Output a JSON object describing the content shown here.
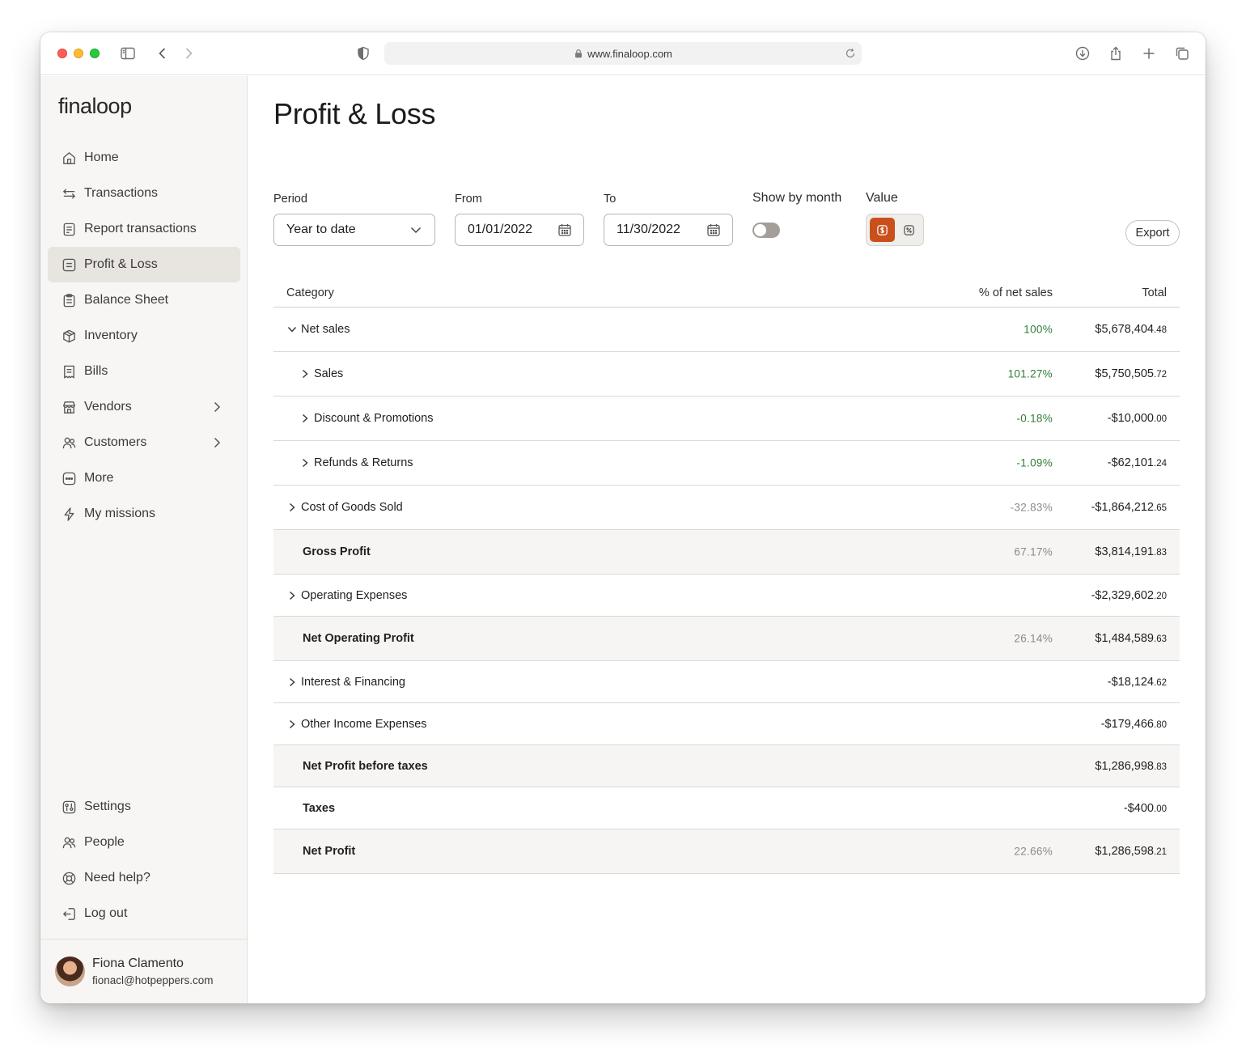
{
  "browser": {
    "url": "www.finaloop.com"
  },
  "sidebar": {
    "logo": "finaloop",
    "items": [
      {
        "label": "Home",
        "icon": "home-icon"
      },
      {
        "label": "Transactions",
        "icon": "transactions-icon"
      },
      {
        "label": "Report transactions",
        "icon": "report-icon"
      },
      {
        "label": "Profit & Loss",
        "icon": "profit-loss-icon",
        "active": true
      },
      {
        "label": "Balance Sheet",
        "icon": "balance-sheet-icon"
      },
      {
        "label": "Inventory",
        "icon": "inventory-icon"
      },
      {
        "label": "Bills",
        "icon": "bills-icon"
      },
      {
        "label": "Vendors",
        "icon": "vendors-icon",
        "has_submenu": true
      },
      {
        "label": "Customers",
        "icon": "customers-icon",
        "has_submenu": true
      },
      {
        "label": "More",
        "icon": "more-icon"
      },
      {
        "label": "My missions",
        "icon": "missions-icon"
      }
    ],
    "bottom_items": [
      {
        "label": "Settings",
        "icon": "settings-icon"
      },
      {
        "label": "People",
        "icon": "people-icon"
      },
      {
        "label": "Need help?",
        "icon": "help-icon"
      },
      {
        "label": "Log out",
        "icon": "logout-icon"
      }
    ],
    "user": {
      "name": "Fiona Clamento",
      "email": "fionacl@hotpeppers.com"
    }
  },
  "page": {
    "title": "Profit & Loss"
  },
  "filters": {
    "period_label": "Period",
    "period_value": "Year to date",
    "from_label": "From",
    "from_value": "01/01/2022",
    "to_label": "To",
    "to_value": "11/30/2022",
    "show_by_month_label": "Show by month",
    "show_by_month": false,
    "value_label": "Value",
    "value_mode": "currency",
    "export_label": "Export"
  },
  "colors": {
    "accent": "#c9501c",
    "positive_pct": "#2e7d3a",
    "muted_pct": "#8a8a8a",
    "row_shade": "#f6f5f3"
  },
  "table": {
    "headers": {
      "category": "Category",
      "pct": "% of net sales",
      "total": "Total"
    },
    "rows": [
      {
        "label": "Net sales",
        "pct": "100%",
        "total_main": "$5,678,404",
        "total_cents": ".48"
      },
      {
        "label": "Sales",
        "pct": "101.27%",
        "total_main": "$5,750,505",
        "total_cents": ".72"
      },
      {
        "label": "Discount & Promotions",
        "pct": "-0.18%",
        "total_main": "-$10,000",
        "total_cents": ".00"
      },
      {
        "label": "Refunds & Returns",
        "pct": "-1.09%",
        "total_main": "-$62,101",
        "total_cents": ".24"
      },
      {
        "label": "Cost of Goods Sold",
        "pct": "-32.83%",
        "total_main": "-$1,864,212",
        "total_cents": ".65"
      },
      {
        "label": "Gross Profit",
        "pct": "67.17%",
        "total_main": "$3,814,191",
        "total_cents": ".83"
      },
      {
        "label": "Operating Expenses",
        "pct": "",
        "total_main": "-$2,329,602",
        "total_cents": ".20"
      },
      {
        "label": "Net Operating Profit",
        "pct": "26.14%",
        "total_main": "$1,484,589",
        "total_cents": ".63"
      },
      {
        "label": "Interest & Financing",
        "pct": "",
        "total_main": "-$18,124",
        "total_cents": ".62"
      },
      {
        "label": "Other Income Expenses",
        "pct": "",
        "total_main": "-$179,466",
        "total_cents": ".80"
      },
      {
        "label": "Net Profit before taxes",
        "pct": "",
        "total_main": "$1,286,998",
        "total_cents": ".83"
      },
      {
        "label": "Taxes",
        "pct": "",
        "total_main": "-$400",
        "total_cents": ".00"
      },
      {
        "label": "Net Profit",
        "pct": "22.66%",
        "total_main": "$1,286,598",
        "total_cents": ".21"
      }
    ]
  }
}
